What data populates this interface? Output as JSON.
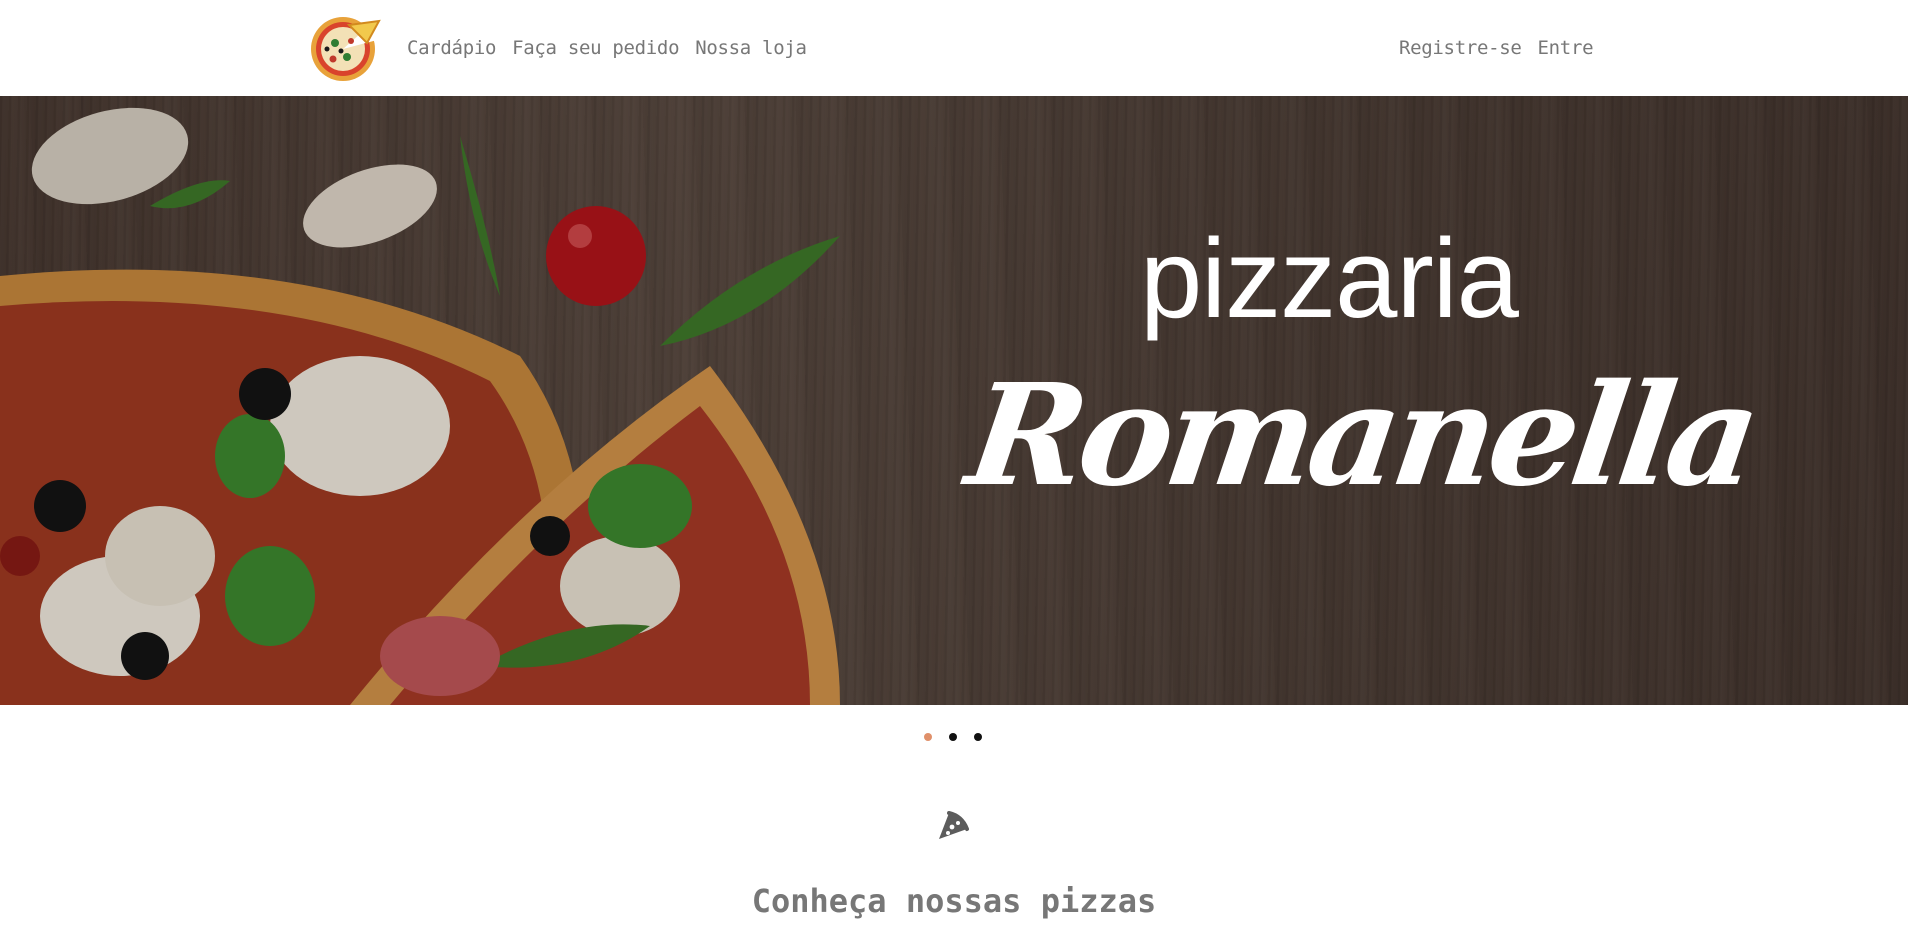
{
  "nav": {
    "left": [
      {
        "label": "Cardápio"
      },
      {
        "label": "Faça seu pedido"
      },
      {
        "label": "Nossa loja"
      }
    ],
    "right": [
      {
        "label": "Registre-se"
      },
      {
        "label": "Entre"
      }
    ]
  },
  "hero": {
    "title_top": "pizzaria",
    "title_script": "Romanella"
  },
  "carousel": {
    "slides": 3,
    "active_index": 0,
    "active_color": "#e0906a",
    "inactive_color": "#111111"
  },
  "section": {
    "icon": "pizza-slice-icon",
    "title": "Conheça nossas pizzas"
  },
  "colors": {
    "nav_text": "#777777",
    "hero_bg": "#4f3f37"
  }
}
